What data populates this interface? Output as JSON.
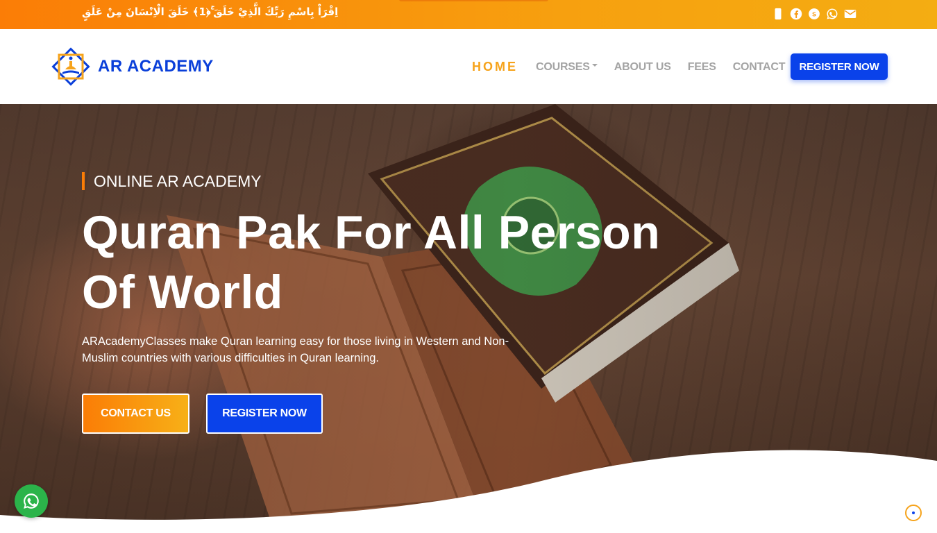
{
  "topbar": {
    "verse": "اِقْرَاْ بِاسْمِ رَبِّكَ الَّذِيْ خَلَقَ ۚ﴿1﴾ خَلَقَ الْاِنْسَانَ مِنْ عَلَقٍ",
    "social_icons": [
      "phone-icon",
      "facebook-icon",
      "skype-icon",
      "whatsapp-icon",
      "envelope-icon"
    ]
  },
  "brand": {
    "name": "AR ACADEMY"
  },
  "nav": {
    "items": [
      {
        "label": "HOME",
        "active": true
      },
      {
        "label": "COURSES",
        "dropdown": true
      },
      {
        "label": "ABOUT US"
      },
      {
        "label": "FEES"
      },
      {
        "label": "CONTACT"
      }
    ],
    "register_label": "REGISTER NOW"
  },
  "hero": {
    "tagline": "ONLINE AR ACADEMY",
    "title": "Quran Pak For All Person Of World",
    "description": "ARAcademyClasses make Quran learning easy for those living in Western and Non-Muslim countries with various difficulties in Quran learning.",
    "contact_label": "CONTACT US",
    "register_label": "REGISTER NOW"
  },
  "floating": {
    "whatsapp_icon": "whatsapp-icon",
    "scroll_icon": "scroll-top-icon"
  },
  "colors": {
    "accent_orange": "#fb7d06",
    "accent_gold": "#f6a31b",
    "brand_blue": "#0a42ea",
    "whatsapp_green": "#2bb44a"
  }
}
